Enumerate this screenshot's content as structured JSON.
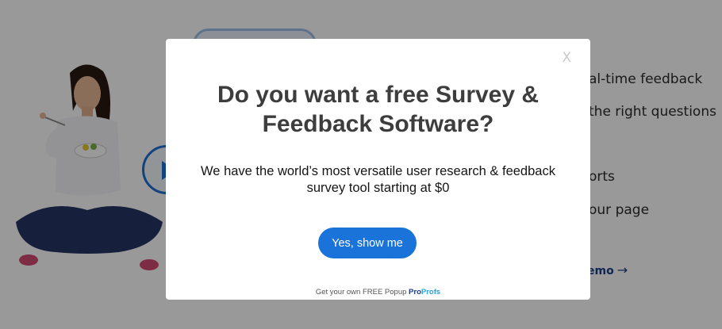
{
  "background": {
    "features": [
      {
        "text": "al-time feedback"
      },
      {
        "text": "the right questions"
      },
      {
        "text": "orts"
      },
      {
        "text": "our page"
      }
    ],
    "demo_link": "emo",
    "demo_arrow": "→"
  },
  "popup": {
    "close_label": "X",
    "title": "Do you want a free Survey & Feedback Software?",
    "subtitle": "We have the world’s most versatile user research & feedback survey tool starting at $0",
    "cta_label": "Yes, show me",
    "footer_text": "Get your own FREE Popup",
    "brand_pro": "Pro",
    "brand_profs": "Profs"
  },
  "colors": {
    "overlay": "rgba(0,0,0,0.40)",
    "cta": "#1a73d9",
    "title": "#3d3d3d",
    "brand_dark": "#1f3c8c",
    "brand_light": "#2ba0e0"
  },
  "icons": {
    "close": "close-icon",
    "play": "play-icon",
    "arrow": "arrow-right-icon"
  }
}
